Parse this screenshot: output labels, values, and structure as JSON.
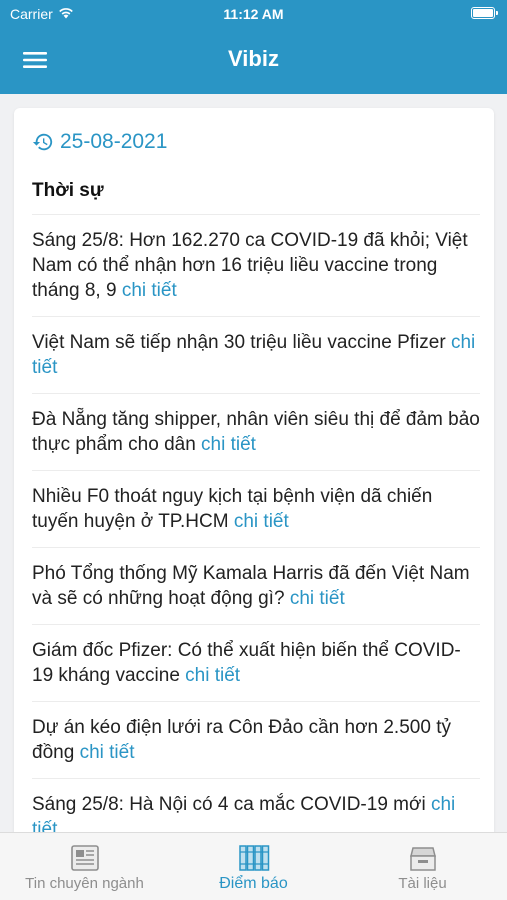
{
  "status": {
    "carrier": "Carrier",
    "time": "11:12 AM"
  },
  "header": {
    "title": "Vibiz",
    "menu_icon": "hamburger-icon"
  },
  "colors": {
    "primary": "#2a95c5",
    "tab_inactive": "#8e8e8e"
  },
  "content": {
    "date": "25-08-2021",
    "section": "Thời sự",
    "more_label": "chi tiết",
    "news": [
      "Sáng 25/8: Hơn 162.270 ca COVID-19 đã khỏi; Việt Nam có thể nhận hơn 16 triệu liều vaccine trong tháng 8, 9",
      "Việt Nam sẽ tiếp nhận 30 triệu liều vaccine Pfizer",
      "Đà Nẵng tăng shipper, nhân viên siêu thị để đảm bảo thực phẩm cho dân",
      "Nhiều F0 thoát nguy kịch tại bệnh viện dã chiến tuyến huyện ở TP.HCM",
      "Phó Tổng thống Mỹ Kamala Harris đã đến Việt Nam và sẽ có những hoạt động gì?",
      "Giám đốc Pfizer: Có thể xuất hiện biến thể COVID-19 kháng vaccine",
      "Dự án kéo điện lưới ra Côn Đảo cần hơn 2.500 tỷ đồng",
      "Sáng 25/8: Hà Nội có 4 ca mắc COVID-19 mới"
    ]
  },
  "tabs": [
    {
      "label": "Tin chuyên ngành",
      "icon": "newspaper-icon",
      "active": false
    },
    {
      "label": "Điểm báo",
      "icon": "binders-icon",
      "active": true
    },
    {
      "label": "Tài liệu",
      "icon": "archive-box-icon",
      "active": false
    }
  ]
}
